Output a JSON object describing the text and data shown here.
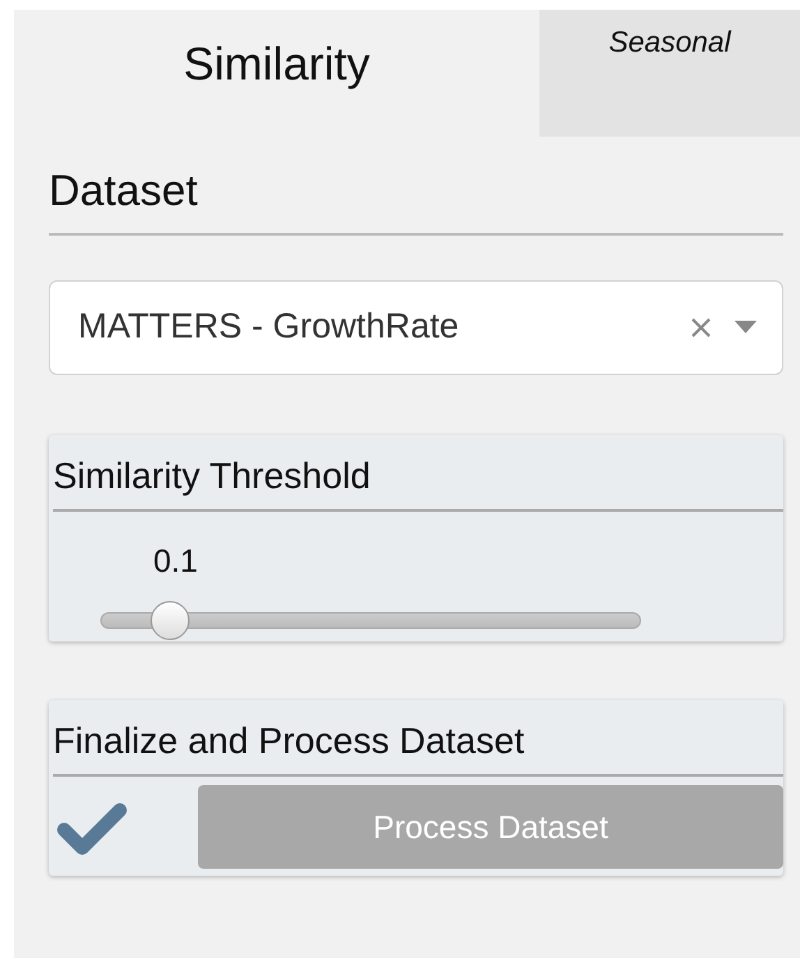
{
  "tabs": [
    {
      "label": "Similarity",
      "selected": true
    },
    {
      "label": "Seasonal",
      "selected": false
    }
  ],
  "dataset": {
    "heading": "Dataset",
    "value": "MATTERS - GrowthRate"
  },
  "threshold": {
    "heading": "Similarity Threshold",
    "reading": "0.1",
    "level": 0.1
  },
  "finalize": {
    "heading": "Finalize and Process Dataset",
    "checked": true,
    "button": {
      "label": "Process Dataset",
      "disabled": true
    }
  }
}
